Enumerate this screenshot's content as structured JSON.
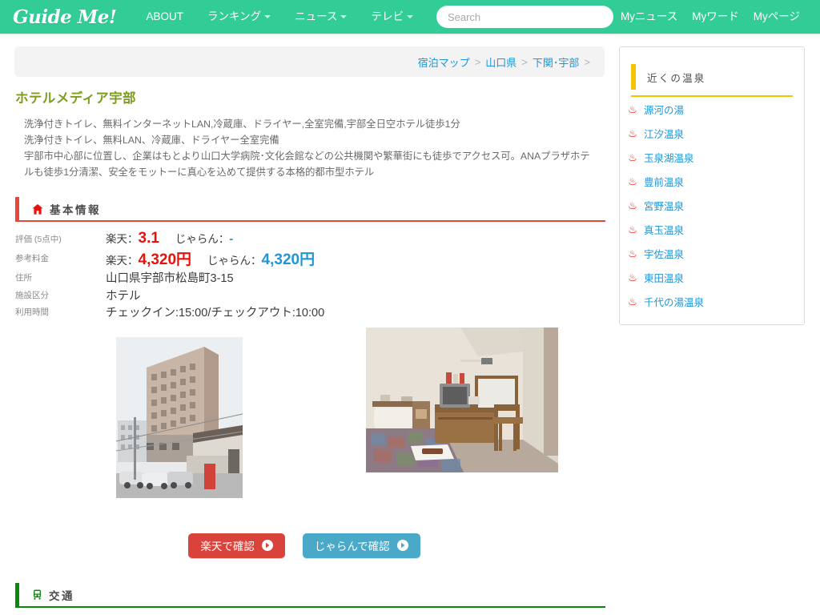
{
  "navbar": {
    "brand": "Guide Me!",
    "links": [
      {
        "label": "ABOUT",
        "caret": false
      },
      {
        "label": "ランキング",
        "caret": true
      },
      {
        "label": "ニュース",
        "caret": true
      },
      {
        "label": "テレビ",
        "caret": true
      }
    ],
    "search": {
      "value": "",
      "placeholder": "Search"
    },
    "right_links": [
      {
        "label": "Myニュース"
      },
      {
        "label": "Myワード"
      },
      {
        "label": "Myページ"
      }
    ],
    "bg_color": "#32cc96"
  },
  "breadcrumb": {
    "items": [
      "宿泊マップ",
      "山口県",
      "下関･宇部"
    ],
    "separator": ">",
    "trailing_separator": ">",
    "link_color": "#2196d6"
  },
  "hotel": {
    "title": "ホテルメディア宇部",
    "title_color": "#7d9e1b",
    "description_lines": [
      "洗浄付きトイレ、無料インターネットLAN,冷蔵庫、ドライヤー,全室完備,宇部全日空ホテル徒歩1分",
      "洗浄付きトイレ、無料LAN、冷蔵庫、ドライヤー全室完備",
      "宇部市中心部に位置し、企業はもとより山口大学病院･文化会館などの公共機関や繁華街にも徒歩でアクセス可。ANAプラザホテ",
      "ルも徒歩1分清潔、安全をモットーに真心を込めて提供する本格的都市型ホテル"
    ]
  },
  "basic_info": {
    "section_title": "基本情報",
    "section_icon": "house-icon",
    "accent_color": "#e8453c",
    "rows": [
      {
        "label": "評価 (5点中)",
        "type": "dual",
        "rakuten_key": "楽天：",
        "rakuten_value": "3.1",
        "jalan_key": "じゃらん：",
        "jalan_value": "-"
      },
      {
        "label": "参考料金",
        "type": "dual_big",
        "rakuten_key": "楽天：",
        "rakuten_value": "4,320円",
        "jalan_key": "じゃらん：",
        "jalan_value": "4,320円"
      },
      {
        "label": "住所",
        "type": "plain",
        "value": "山口県宇部市松島町3-15"
      },
      {
        "label": "施設区分",
        "type": "plain",
        "value": "ホテル"
      },
      {
        "label": "利用時間",
        "type": "plain",
        "value": "チェックイン:15:00/チェックアウト:10:00"
      }
    ]
  },
  "photos": [
    {
      "name": "hotel-exterior-photo",
      "alt": "ホテル外観"
    },
    {
      "name": "hotel-room-photo",
      "alt": "客室"
    }
  ],
  "cta": {
    "rakuten": {
      "label": "楽天で確認",
      "color": "#d9433c",
      "icon": "arrow-right-circle-icon"
    },
    "jalan": {
      "label": "じゃらんで確認",
      "color": "#4aa8c9",
      "icon": "arrow-right-circle-icon"
    }
  },
  "sidebar": {
    "title": "近くの温泉",
    "accent_color": "#f5c400",
    "item_icon": "hot-spring-icon",
    "items": [
      {
        "label": "源河の湯"
      },
      {
        "label": "江汐温泉"
      },
      {
        "label": "玉泉湖温泉"
      },
      {
        "label": "豊前温泉"
      },
      {
        "label": "宮野温泉"
      },
      {
        "label": "真玉温泉"
      },
      {
        "label": "宇佐温泉"
      },
      {
        "label": "東田温泉"
      },
      {
        "label": "千代の湯温泉"
      }
    ]
  },
  "transport": {
    "section_title": "交通",
    "section_icon": "train-icon",
    "accent_color": "#0a8a0a"
  }
}
